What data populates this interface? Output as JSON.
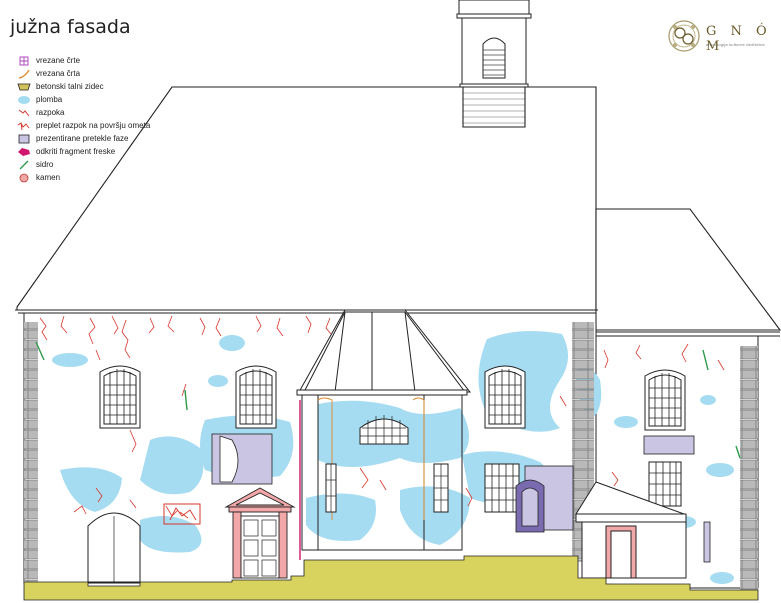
{
  "title": "južna fasada",
  "logo": {
    "name": "G N Ó M",
    "tagline": "arheologija kulturne dediščine",
    "color": "#6b5a2a"
  },
  "legend": [
    {
      "label": "vrezane črte",
      "symbol": "incised-lines-icon",
      "color": "#b04ac0"
    },
    {
      "label": "vrezana  črta",
      "symbol": "incised-line-icon",
      "color": "#e08a2a"
    },
    {
      "label": "betonski talni zidec",
      "symbol": "concrete-plinth-icon",
      "color": "#cfc35a"
    },
    {
      "label": "plomba",
      "symbol": "patch-icon",
      "color": "#a6dcf2"
    },
    {
      "label": "razpoka",
      "symbol": "crack-icon",
      "color": "#d8352a"
    },
    {
      "label": "preplet razpok na površju ometa",
      "symbol": "crack-network-icon",
      "color": "#d8352a"
    },
    {
      "label": "prezentirane pretekle faze",
      "symbol": "past-phase-icon",
      "color": "#c9c5e2"
    },
    {
      "label": "odkriti fragment freske",
      "symbol": "fresco-fragment-icon",
      "color": "#d0166e"
    },
    {
      "label": "sidro",
      "symbol": "anchor-icon",
      "color": "#2f9a4a"
    },
    {
      "label": "kamen",
      "symbol": "stone-icon",
      "color": "#f2a8a8"
    }
  ],
  "colors": {
    "line": "#222222",
    "quoin": "#b9b9b9",
    "plinth": "#d8d25f",
    "patch": "#a6dcf2",
    "crack": "#d8352a",
    "past_phase": "#c9c5e2",
    "stone": "#f2a8a8",
    "fresco": "#d0166e",
    "anchor": "#2f9a4a",
    "incised": "#e08a2a"
  }
}
